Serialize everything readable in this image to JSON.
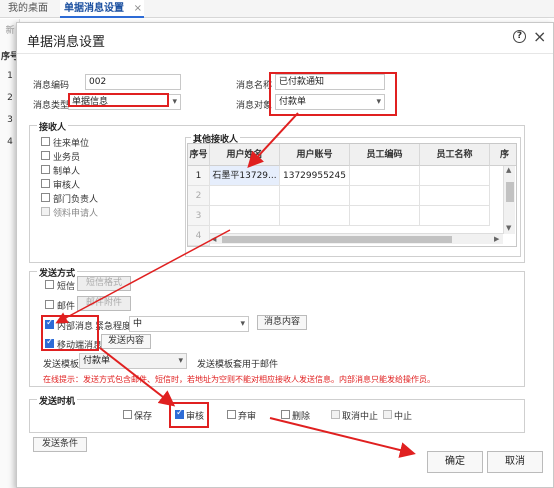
{
  "bg": {
    "tabs": [
      {
        "label": "我的桌面"
      },
      {
        "label": "单据消息设置",
        "close": "×"
      }
    ],
    "grid_header": "序号",
    "row_numbers": [
      "1",
      "2",
      "3",
      "4"
    ],
    "left_clip": [
      "新",
      "序号"
    ]
  },
  "dialog": {
    "title": "单据消息设置",
    "help_glyph": "?",
    "close_glyph": "×"
  },
  "form": {
    "code_label": "消息编码",
    "code_value": "002",
    "name_label": "消息名称",
    "name_value": "已付款通知",
    "type_label": "消息类型",
    "type_value": "单据信息",
    "target_label": "消息对象",
    "target_value": "付款单"
  },
  "receivers": {
    "title": "接收人",
    "items": [
      {
        "label": "往来单位",
        "checked": false
      },
      {
        "label": "业务员",
        "checked": false
      },
      {
        "label": "制单人",
        "checked": false
      },
      {
        "label": "审核人",
        "checked": false
      },
      {
        "label": "部门负责人",
        "checked": false
      },
      {
        "label": "领料申请人",
        "checked": false
      }
    ],
    "other_title": "其他接收人",
    "columns": [
      "序号",
      "用户姓名",
      "用户账号",
      "员工编码",
      "员工名称",
      "序"
    ],
    "rows": [
      [
        "1",
        "石墨平13729...",
        "13729955245",
        "",
        ""
      ],
      [
        "2",
        "",
        "",
        "",
        ""
      ],
      [
        "3",
        "",
        "",
        "",
        ""
      ],
      [
        "4",
        "",
        "",
        "",
        ""
      ]
    ]
  },
  "send": {
    "title": "发送方式",
    "sms_label": "短信",
    "sms_format_btn": "短信格式",
    "mail_label": "邮件",
    "mail_attach_btn": "邮件附件",
    "internal_label": "内部消息",
    "urgency_label": "紧急程度",
    "urgency_value": "中",
    "msg_content_btn": "消息内容",
    "mobile_label": "移动端消息",
    "mobile_content_btn": "发送内容",
    "template_label": "发送模板",
    "template_value": "付款单",
    "template_note": "发送模板套用于邮件",
    "warning": "在线提示：发送方式包含邮件、短信时，若地址为空则不能对相应接收人发送信息。内部消息只能发给操作员。"
  },
  "timing": {
    "title": "发送时机",
    "options": [
      {
        "label": "保存",
        "checked": false
      },
      {
        "label": "审核",
        "checked": true
      },
      {
        "label": "弃审",
        "checked": false
      },
      {
        "label": "删除",
        "checked": false
      },
      {
        "label": "取消中止",
        "checked": false
      },
      {
        "label": "中止",
        "checked": false
      }
    ]
  },
  "footer": {
    "conditions_btn": "发送条件",
    "ok_btn": "确定",
    "cancel_btn": "取消"
  },
  "colors": {
    "annotation": "#e02020",
    "accent": "#2d6bd6"
  }
}
